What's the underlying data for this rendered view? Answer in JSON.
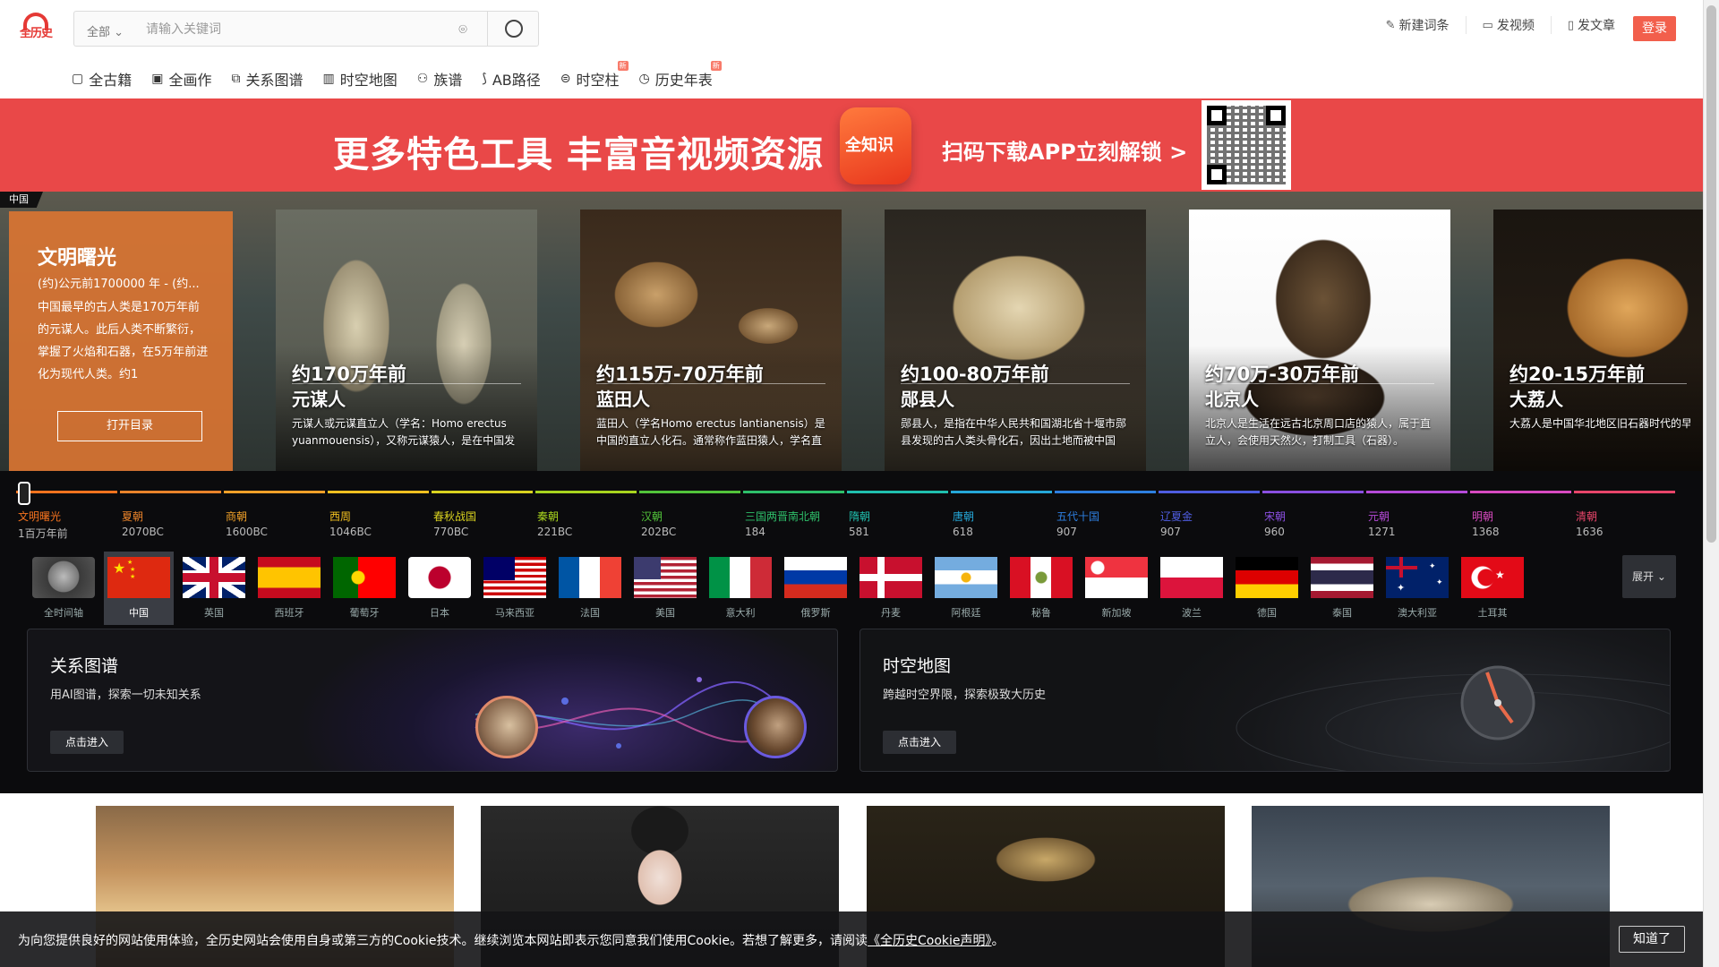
{
  "header": {
    "logo_text": "全历史",
    "search_scope": "全部",
    "search_placeholder": "请输入关键词",
    "links": [
      {
        "icon": "edit-icon",
        "label": "新建词条"
      },
      {
        "icon": "video-icon",
        "label": "发视频"
      },
      {
        "icon": "document-icon",
        "label": "发文章"
      }
    ],
    "login_label": "登录"
  },
  "nav": [
    {
      "icon": "book-icon",
      "label": "全古籍",
      "badge": ""
    },
    {
      "icon": "picture-icon",
      "label": "全画作",
      "badge": ""
    },
    {
      "icon": "graph-icon",
      "label": "关系图谱",
      "badge": ""
    },
    {
      "icon": "map-icon",
      "label": "时空地图",
      "badge": ""
    },
    {
      "icon": "person-icon",
      "label": "族谱",
      "badge": ""
    },
    {
      "icon": "route-icon",
      "label": "AB路径",
      "badge": ""
    },
    {
      "icon": "cylinder-icon",
      "label": "时空柱",
      "badge": "新"
    },
    {
      "icon": "clock-icon",
      "label": "历史年表",
      "badge": "新"
    }
  ],
  "banner": {
    "headline": "更多特色工具 丰富音视频资源",
    "app_name": "全知识",
    "cta": "扫码下载APP立刻解锁 >"
  },
  "timeline": {
    "country_tag": "中国",
    "intro": {
      "title": "文明曙光",
      "date": "(约)公元前1700000 年 - (约...",
      "text": "中国最早的古人类是170万年前的元谋人。此后人类不断繁衍，掌握了火焰和石器，在5万年前进化为现代人类。约1",
      "button": "打开目录"
    },
    "cards": [
      {
        "period": "约170万年前",
        "name": "元谋人",
        "desc": "元谋人或元谋直立人（学名：Homo erectus yuanmouensis），又称元谋猿人，是在中国发"
      },
      {
        "period": "约115万-70万年前",
        "name": "蓝田人",
        "desc": "蓝田人（学名Homo erectus lantianensis）是中国的直立人化石。通常称作蓝田猿人，学名直"
      },
      {
        "period": "约100-80万年前",
        "name": "郧县人",
        "desc": "郧县人，是指在中华人民共和国湖北省十堰市郧县发现的古人类头骨化石，因出土地而被中国"
      },
      {
        "period": "约70万-30万年前",
        "name": "北京人",
        "desc": "北京人是生活在远古北京周口店的猿人，属于直立人，会使用天然火，打制工具（石器）。"
      },
      {
        "period": "约20-15万年前",
        "name": "大荔人",
        "desc": "大荔人是中国华北地区旧石器时代的早期人类，因化石发现于陕西省渭南市大荔县解放村"
      }
    ],
    "dynasties": [
      {
        "name": "文明曙光",
        "year": "1百万年前",
        "color": "#f5731e"
      },
      {
        "name": "夏朝",
        "year": "2070BC",
        "color": "#e9832a"
      },
      {
        "name": "商朝",
        "year": "1600BC",
        "color": "#f0a028"
      },
      {
        "name": "西周",
        "year": "1046BC",
        "color": "#f2c020"
      },
      {
        "name": "春秋战国",
        "year": "770BC",
        "color": "#d9d21f"
      },
      {
        "name": "秦朝",
        "year": "221BC",
        "color": "#a8d41e"
      },
      {
        "name": "汉朝",
        "year": "202BC",
        "color": "#52c43a"
      },
      {
        "name": "三国两晋南北朝",
        "year": "184",
        "color": "#2ebf6a"
      },
      {
        "name": "隋朝",
        "year": "581",
        "color": "#20bfae"
      },
      {
        "name": "唐朝",
        "year": "618",
        "color": "#25a7d8"
      },
      {
        "name": "五代十国",
        "year": "907",
        "color": "#2e7fe0"
      },
      {
        "name": "辽夏金",
        "year": "907",
        "color": "#4f5de0"
      },
      {
        "name": "宋朝",
        "year": "960",
        "color": "#8a4fe0"
      },
      {
        "name": "元朝",
        "year": "1271",
        "color": "#b54ad8"
      },
      {
        "name": "明朝",
        "year": "1368",
        "color": "#d84ac0"
      },
      {
        "name": "清朝",
        "year": "1636",
        "color": "#e8456a"
      }
    ]
  },
  "countries": {
    "items": [
      "全时间轴",
      "中国",
      "英国",
      "西班牙",
      "葡萄牙",
      "日本",
      "马来西亚",
      "法国",
      "美国",
      "意大利",
      "俄罗斯",
      "丹麦",
      "阿根廷",
      "秘鲁",
      "新加坡",
      "波兰",
      "德国",
      "泰国",
      "澳大利亚",
      "土耳其"
    ],
    "selected": "中国",
    "expand_label": "展开"
  },
  "features": [
    {
      "title": "关系图谱",
      "subtitle": "用AI图谱，探索一切未知关系",
      "button": "点击进入"
    },
    {
      "title": "时空地图",
      "subtitle": "跨越时空界限，探索极致大历史",
      "button": "点击进入"
    }
  ],
  "cookie": {
    "text": "为向您提供良好的网站使用体验，全历史网站会使用自身或第三方的Cookie技术。继续浏览本网站即表示您同意我们使用Cookie。若想了解更多，请阅读",
    "link": "《全历史Cookie声明》",
    "end": "。",
    "button": "知道了"
  }
}
